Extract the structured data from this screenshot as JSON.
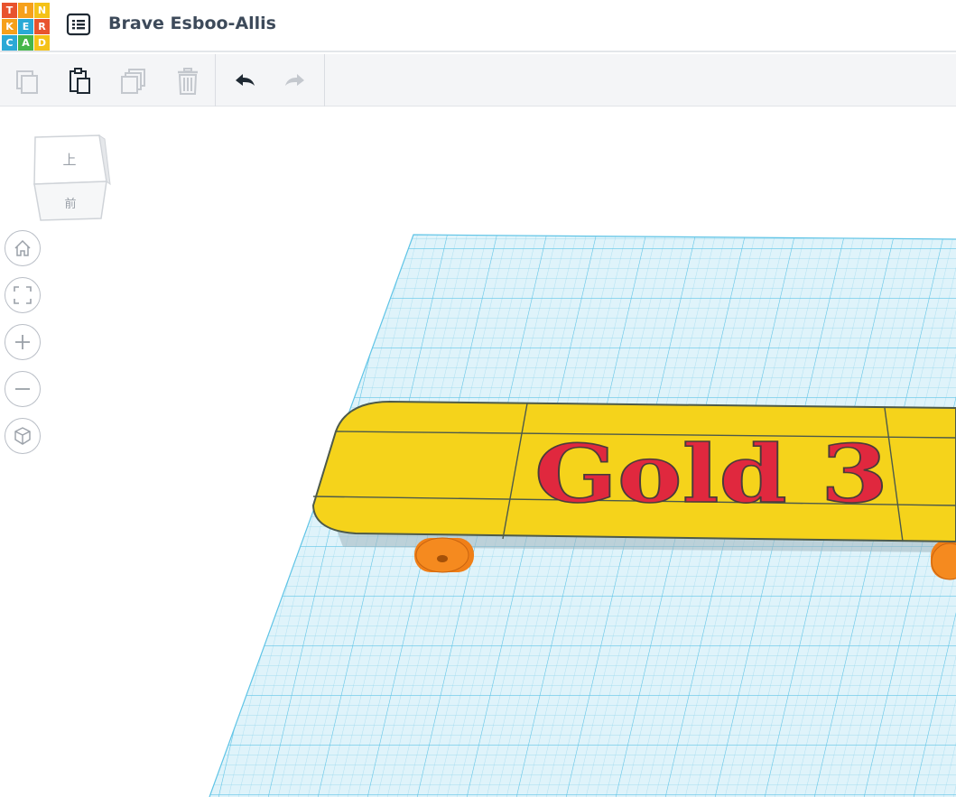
{
  "logo": {
    "letters": [
      "T",
      "I",
      "N",
      "K",
      "E",
      "R",
      "C",
      "A",
      "D"
    ],
    "colors": [
      "#e8532e",
      "#f6a01a",
      "#f4c218",
      "#f6a01a",
      "#2aa9d6",
      "#e8532e",
      "#2aa9d6",
      "#45b649",
      "#f4c218"
    ]
  },
  "header": {
    "design_list_icon": "list-icon",
    "title": "Brave Esboo-Allis"
  },
  "toolbar": {
    "items": [
      {
        "name": "copy",
        "icon": "copy-icon",
        "enabled": false
      },
      {
        "name": "paste",
        "icon": "paste-icon",
        "enabled": true
      },
      {
        "name": "duplicate",
        "icon": "duplicate-icon",
        "enabled": false
      },
      {
        "name": "delete",
        "icon": "trash-icon",
        "enabled": false
      },
      {
        "name": "undo",
        "icon": "undo-icon",
        "enabled": true
      },
      {
        "name": "redo",
        "icon": "redo-icon",
        "enabled": false
      }
    ]
  },
  "viewcube": {
    "top_label": "上",
    "front_label": "前"
  },
  "view_controls": [
    {
      "name": "home-view",
      "icon": "home-icon"
    },
    {
      "name": "fit-all",
      "icon": "fit-icon"
    },
    {
      "name": "zoom-in",
      "icon": "plus-icon"
    },
    {
      "name": "zoom-out",
      "icon": "minus-icon"
    },
    {
      "name": "perspective",
      "icon": "cube-icon"
    }
  ],
  "scene": {
    "model_text": "Gold 3",
    "colors": {
      "grid": "#5fc4e6",
      "grid_fill": "#d8f0f9",
      "board": "#f5d31b",
      "text": "#e0283e",
      "wheels": "#f07f17"
    }
  }
}
